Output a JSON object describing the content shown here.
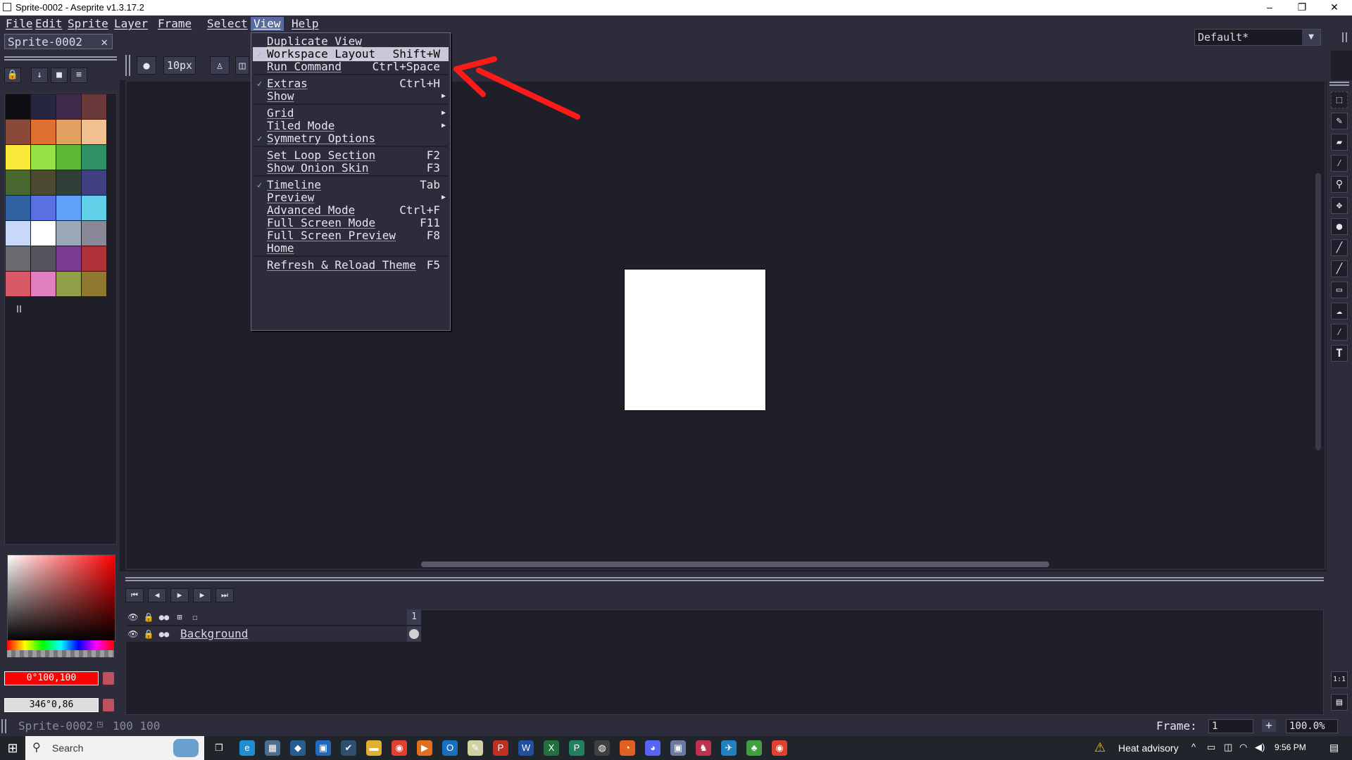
{
  "window": {
    "title": "Sprite-0002 - Aseprite v1.3.17.2",
    "min": "–",
    "max": "❐",
    "close": "✕"
  },
  "menubar": [
    "File",
    "Edit",
    "Sprite",
    "Layer",
    "Frame",
    "Select",
    "View",
    "Help"
  ],
  "tab": {
    "label": "Sprite-0002",
    "close": "✕"
  },
  "layout_select": {
    "value": "Default*"
  },
  "context_bar": {
    "brush_size": "10px"
  },
  "palette": [
    "#0d0d12",
    "#262640",
    "#3e2a48",
    "#6a3a3a",
    "#8a4a3a",
    "#e07030",
    "#e0a060",
    "#f0c090",
    "#f8e838",
    "#98e048",
    "#60b838",
    "#309068",
    "#486830",
    "#4a4a30",
    "#304038",
    "#404080",
    "#3060a0",
    "#5870e0",
    "#60a0f8",
    "#60d0e8",
    "#c8d8f8",
    "#ffffff",
    "#9aa8b8",
    "#888896",
    "#6a6a70",
    "#54545e",
    "#7a3a90",
    "#b03038",
    "#d85868",
    "#e080c0",
    "#90a048",
    "#907830"
  ],
  "colors": {
    "fg_label": "0°100,100",
    "bg_label": "346°0,86"
  },
  "view_menu": {
    "items": [
      {
        "label": "Duplicate View",
        "shortcut": ""
      },
      {
        "label": "Workspace Layout",
        "shortcut": "Shift+W",
        "checked": true
      },
      {
        "label": "Run Command",
        "shortcut": "Ctrl+Space"
      },
      {
        "label": "Extras",
        "shortcut": "Ctrl+H",
        "checked": true
      },
      {
        "label": "Show",
        "shortcut": "",
        "submenu": true
      },
      {
        "label": "Grid",
        "shortcut": "",
        "submenu": true
      },
      {
        "label": "Tiled Mode",
        "shortcut": "",
        "submenu": true
      },
      {
        "label": "Symmetry Options",
        "shortcut": "",
        "checked": true
      },
      {
        "label": "Set Loop Section",
        "shortcut": "F2"
      },
      {
        "label": "Show Onion Skin",
        "shortcut": "F3"
      },
      {
        "label": "Timeline",
        "shortcut": "Tab",
        "checked": true
      },
      {
        "label": "Preview",
        "shortcut": "",
        "submenu": true
      },
      {
        "label": "Advanced Mode",
        "shortcut": "Ctrl+F"
      },
      {
        "label": "Full Screen Mode",
        "shortcut": "F11"
      },
      {
        "label": "Full Screen Preview",
        "shortcut": "F8"
      },
      {
        "label": "Home",
        "shortcut": ""
      },
      {
        "label": "Refresh & Reload Theme",
        "shortcut": "F5"
      }
    ]
  },
  "timeline": {
    "layer_name": "Background",
    "frame_number": "1"
  },
  "status": {
    "sprite_name": "Sprite-0002",
    "size": "100 100",
    "frame_label": "Frame:",
    "frame_value": "1",
    "add": "+",
    "zoom": "100.0%"
  },
  "taskbar": {
    "search": "Search",
    "weather": "Heat advisory",
    "time": "9:56 PM"
  },
  "accent": "#5a6a9e",
  "annotation_color": "#ff1a1a"
}
